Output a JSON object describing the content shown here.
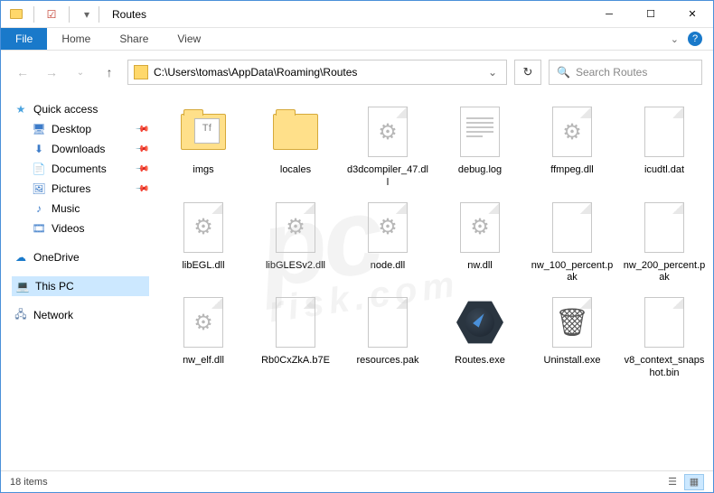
{
  "window": {
    "title": "Routes"
  },
  "ribbon": {
    "file": "File",
    "tabs": [
      "Home",
      "Share",
      "View"
    ]
  },
  "nav": {
    "path": "C:\\Users\\tomas\\AppData\\Roaming\\Routes",
    "search_placeholder": "Search Routes"
  },
  "sidebar": {
    "quick": {
      "label": "Quick access",
      "items": [
        {
          "label": "Desktop",
          "pinned": true,
          "icon": "desktop"
        },
        {
          "label": "Downloads",
          "pinned": true,
          "icon": "downloads"
        },
        {
          "label": "Documents",
          "pinned": true,
          "icon": "documents"
        },
        {
          "label": "Pictures",
          "pinned": true,
          "icon": "pictures"
        },
        {
          "label": "Music",
          "pinned": false,
          "icon": "music"
        },
        {
          "label": "Videos",
          "pinned": false,
          "icon": "videos"
        }
      ]
    },
    "onedrive": "OneDrive",
    "thispc": "This PC",
    "network": "Network"
  },
  "files": [
    {
      "name": "imgs",
      "type": "folder-preview"
    },
    {
      "name": "locales",
      "type": "folder"
    },
    {
      "name": "d3dcompiler_47.dll",
      "type": "gear"
    },
    {
      "name": "debug.log",
      "type": "text"
    },
    {
      "name": "ffmpeg.dll",
      "type": "gear"
    },
    {
      "name": "icudtl.dat",
      "type": "blank"
    },
    {
      "name": "libEGL.dll",
      "type": "gear"
    },
    {
      "name": "libGLESv2.dll",
      "type": "gear"
    },
    {
      "name": "node.dll",
      "type": "gear"
    },
    {
      "name": "nw.dll",
      "type": "gear"
    },
    {
      "name": "nw_100_percent.pak",
      "type": "blank"
    },
    {
      "name": "nw_200_percent.pak",
      "type": "blank"
    },
    {
      "name": "nw_elf.dll",
      "type": "gear"
    },
    {
      "name": "Rb0CxZkA.b7E",
      "type": "blank"
    },
    {
      "name": "resources.pak",
      "type": "blank"
    },
    {
      "name": "Routes.exe",
      "type": "exe-compass"
    },
    {
      "name": "Uninstall.exe",
      "type": "exe-bin"
    },
    {
      "name": "v8_context_snapshot.bin",
      "type": "blank"
    }
  ],
  "status": {
    "count_label": "18 items"
  },
  "watermark": {
    "top": "pc",
    "bottom": "risk.com"
  }
}
